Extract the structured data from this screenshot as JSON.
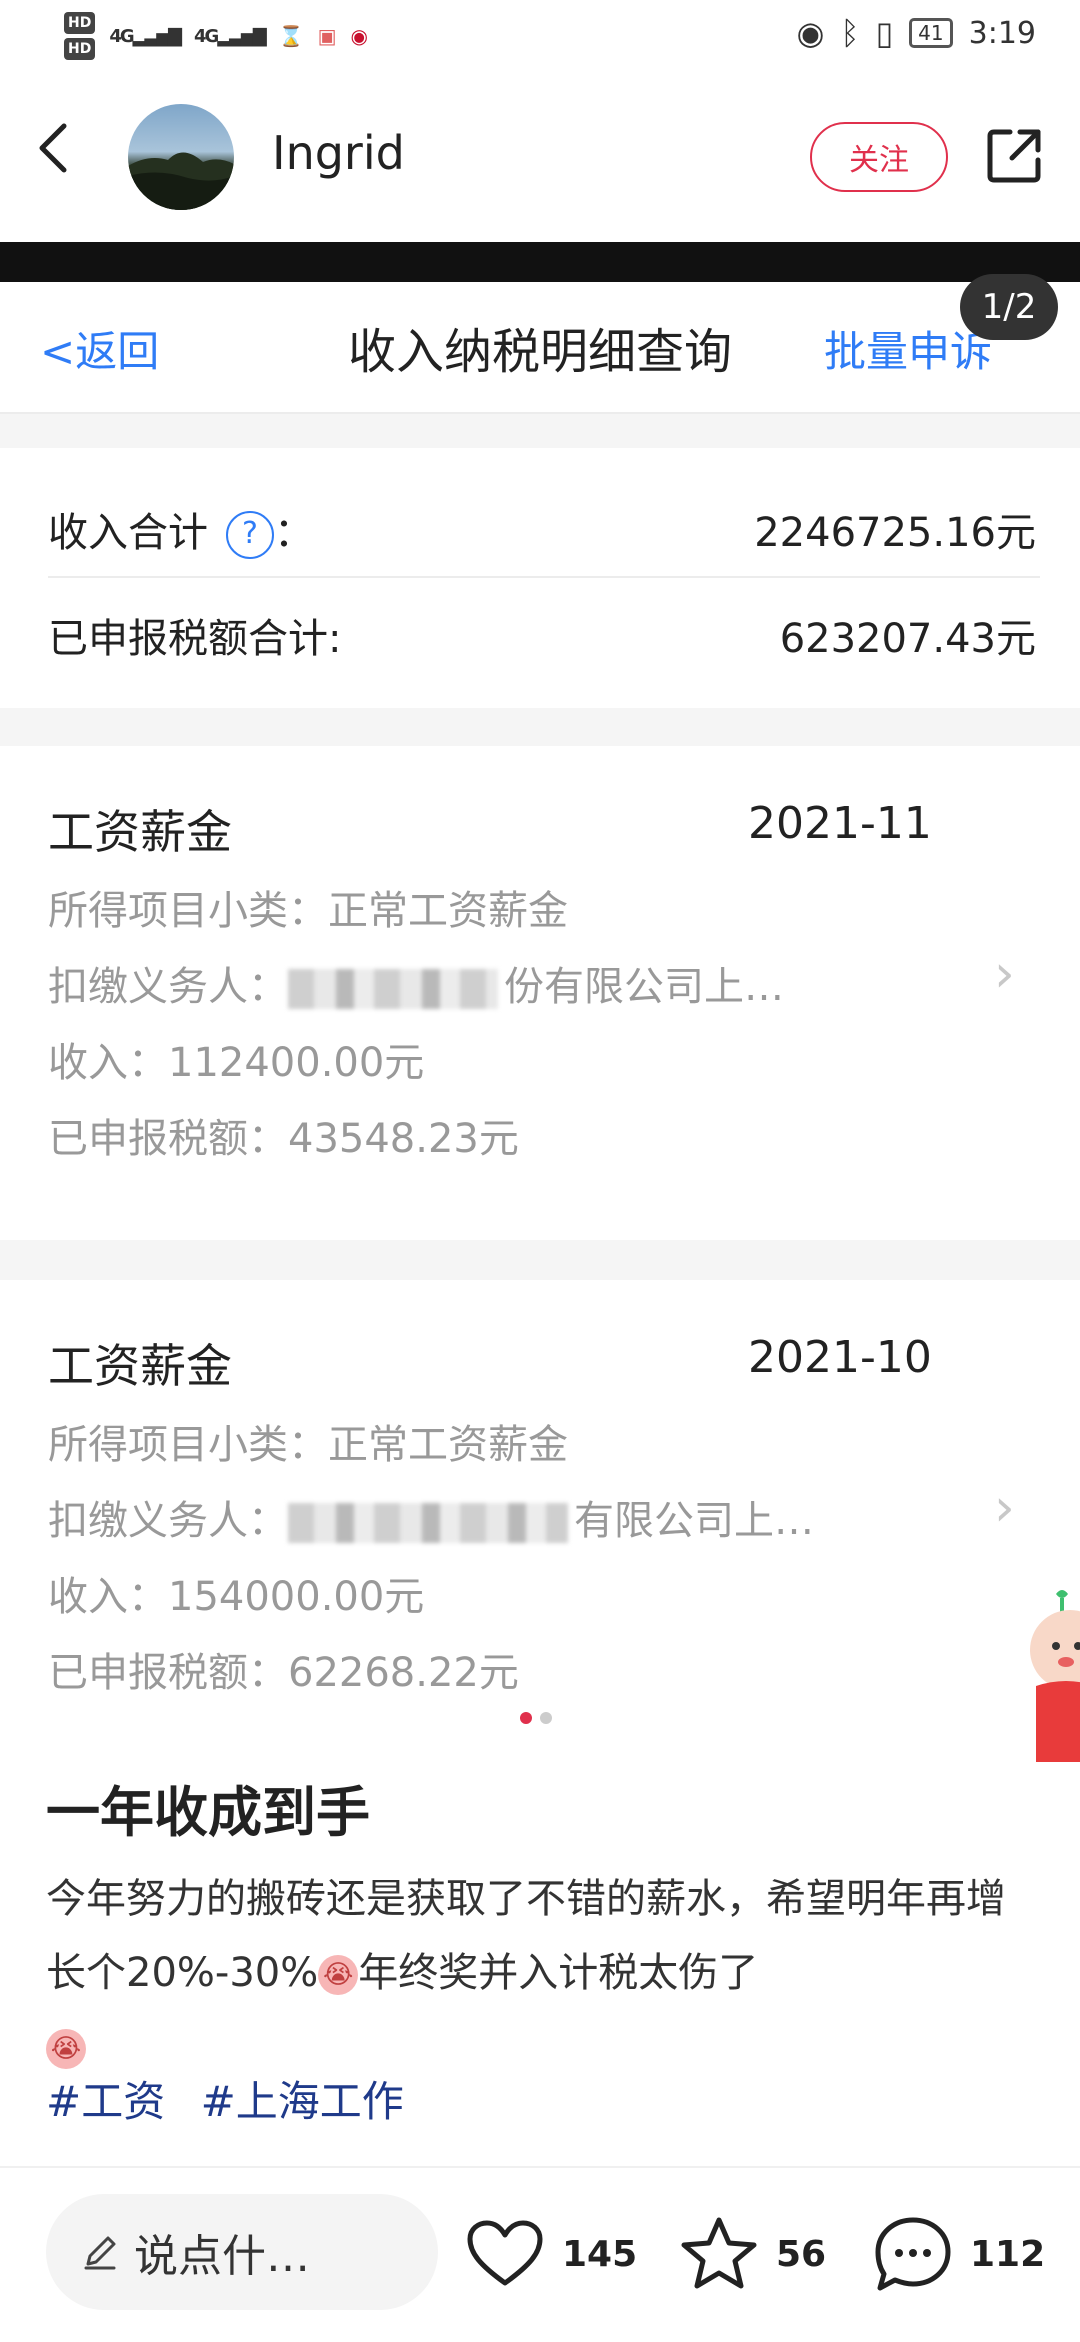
{
  "status_bar": {
    "hd1": "HD",
    "hd2": "HD",
    "signal1": "4G",
    "signal2": "4G",
    "battery": "41",
    "time": "3:19"
  },
  "header": {
    "username": "Ingrid",
    "follow_label": "关注"
  },
  "screenshot": {
    "pager": "1/2",
    "nav_back": "返回",
    "nav_title": "收入纳税明细查询",
    "nav_batch": "批量申诉",
    "income_total_label": "收入合计",
    "income_total_colon": "：",
    "income_total_value": "2246725.16元",
    "tax_total_label": "已申报税额合计:",
    "tax_total_value": "623207.43元",
    "records": [
      {
        "title": "工资薪金",
        "date": "2021-11",
        "subcategory": "所得项目小类：正常工资薪金",
        "withholder_label": "扣缴义务人：",
        "withholder_visible": "份有限公司上…",
        "income": "收入：112400.00元",
        "tax": "已申报税额：43548.23元"
      },
      {
        "title": "工资薪金",
        "date": "2021-10",
        "subcategory": "所得项目小类：正常工资薪金",
        "withholder_label": "扣缴义务人：",
        "withholder_visible": "有限公司上…",
        "income": "收入：154000.00元",
        "tax": "已申报税额：62268.22元"
      }
    ]
  },
  "post": {
    "title": "一年收成到手",
    "body_part1": "今年努力的搬砖还是获取了不错的薪水，希望明年再增长个20%-30%",
    "body_part2": "年终奖并入计税太伤了",
    "tags": [
      "#工资",
      "#上海工作"
    ]
  },
  "bottom_bar": {
    "comment_placeholder": "说点什…",
    "likes": "145",
    "stars": "56",
    "comments": "112"
  },
  "colors": {
    "accent_red": "#e0304c",
    "link_blue": "#2f7cf6",
    "tag_blue": "#1f3a8a"
  }
}
